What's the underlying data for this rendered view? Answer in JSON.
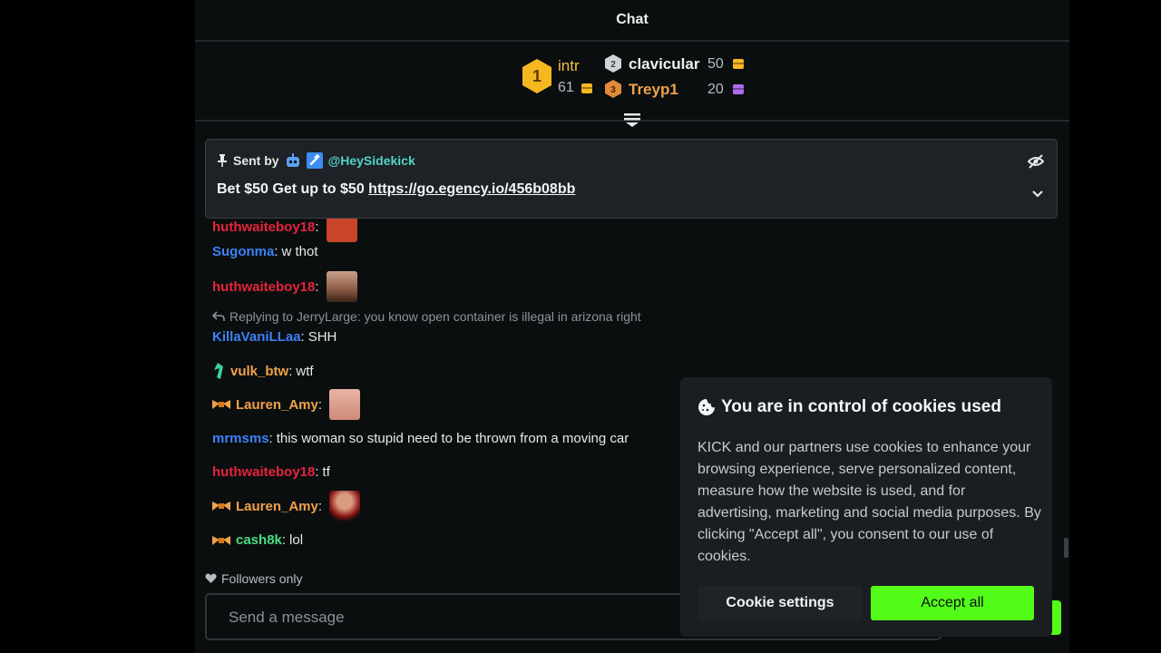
{
  "header": {
    "title": "Chat"
  },
  "leaderboard": {
    "first": {
      "rank": "1",
      "name": "intr",
      "amount": "61",
      "color": "#f3c13a"
    },
    "second": {
      "rank": "2",
      "name": "clavicular",
      "amount": "50",
      "color": "#f0f0f0"
    },
    "third": {
      "rank": "3",
      "name": "Treyp1",
      "amount": "20",
      "color": "#f0a14c"
    }
  },
  "pinned": {
    "sent_by": "Sent by",
    "handle": "@HeySidekick",
    "message": "Bet $50 Get up to $50",
    "link": "https://go.egency.io/456b08bb"
  },
  "messages": [
    {
      "user": "Sugonma",
      "color": "#3b82f6",
      "text": "w thot"
    },
    {
      "user": "huthwaiteboy18",
      "color": "#e5243b",
      "text": ""
    },
    {
      "user": "KillaVaniLLaa",
      "color": "#3b82f6",
      "text": "SHH"
    },
    {
      "user": "vulk_btw",
      "color": "#f0a14c",
      "text": "wtf"
    },
    {
      "user": "Lauren_Amy",
      "color": "#f0a14c",
      "text": ""
    },
    {
      "user": "mrmsms",
      "color": "#3b82f6",
      "text": "this woman so stupid need to be thrown from a moving car"
    },
    {
      "user": "huthwaiteboy18",
      "color": "#e5243b",
      "text": "tf"
    },
    {
      "user": "Lauren_Amy",
      "color": "#f0a14c",
      "text": ""
    },
    {
      "user": "cash8k",
      "color": "#4ade80",
      "text": "lol"
    }
  ],
  "reply": {
    "text": "Replying to JerryLarge: you know open container is illegal in arizona right"
  },
  "followers": {
    "label": "Followers only"
  },
  "input": {
    "placeholder": "Send a message"
  },
  "cookie": {
    "title": "You are in control of cookies used",
    "body": "KICK and our partners use cookies to enhance your browsing experience, serve personalized content, measure how the website is used, and for advertising, marketing and social media purposes. By clicking \"Accept all\", you consent to our use of cookies.",
    "settings_label": "Cookie settings",
    "accept_label": "Accept all"
  },
  "colors": {
    "brand_green": "#53fc18",
    "panel_bg": "#0b0e0f"
  }
}
